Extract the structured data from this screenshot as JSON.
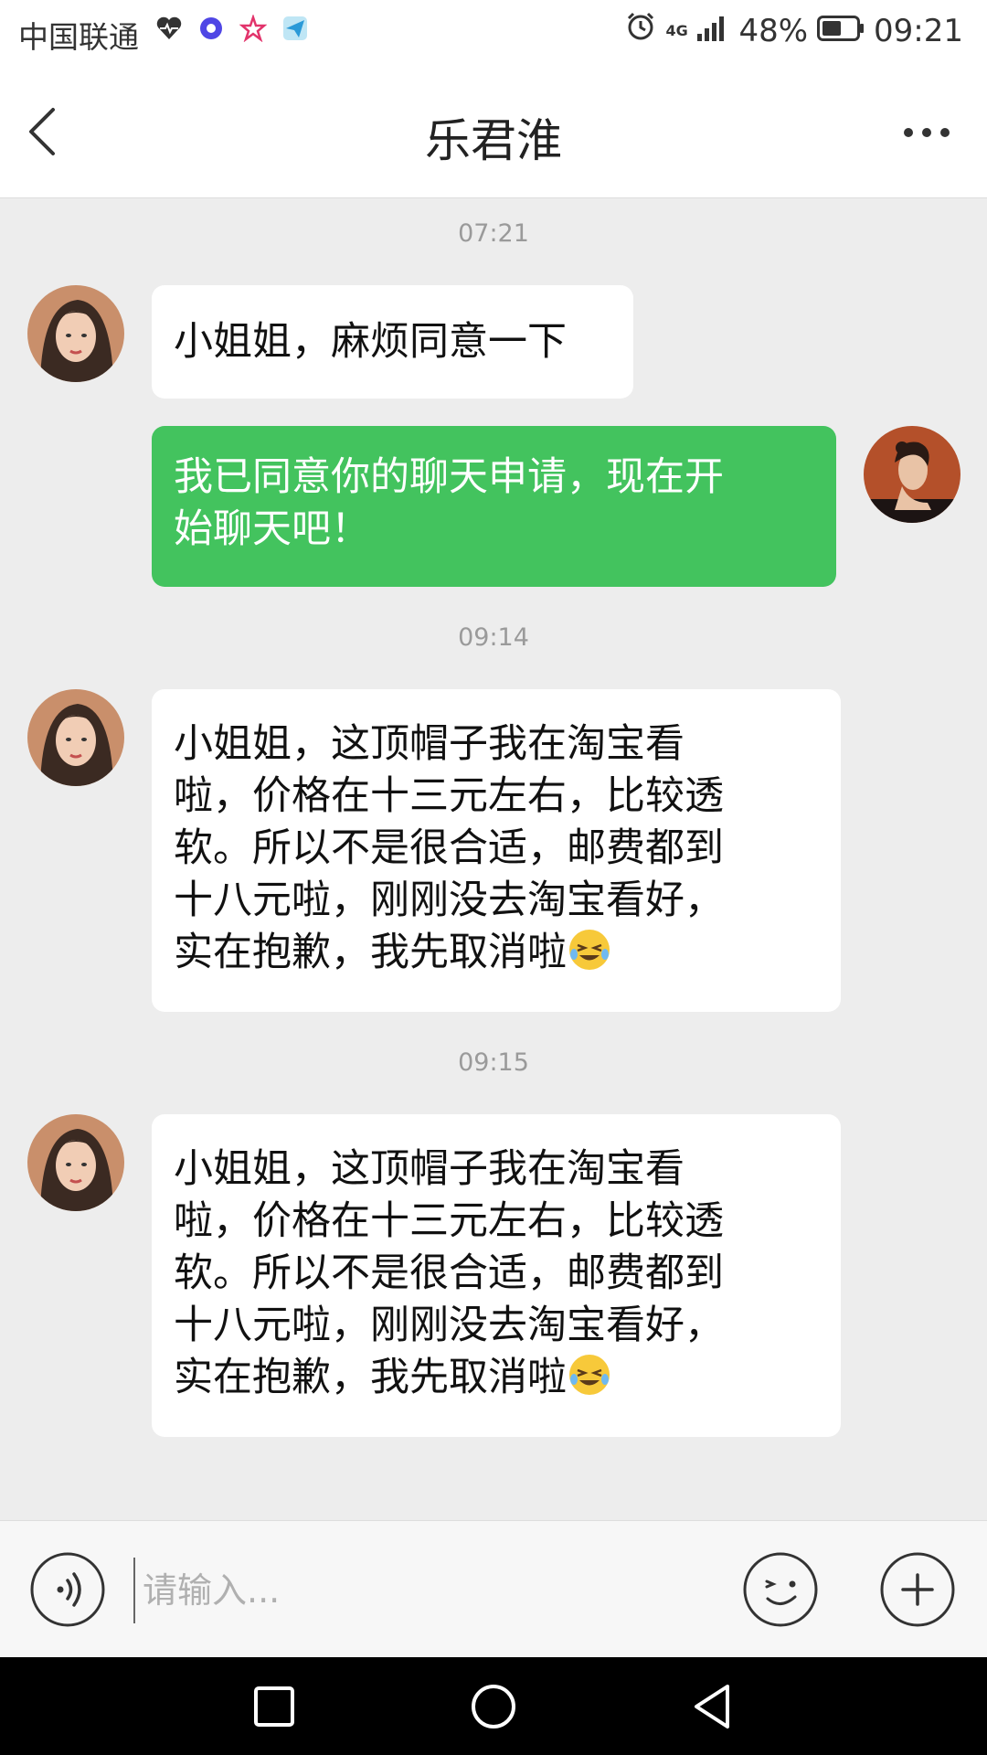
{
  "status_bar": {
    "carrier": "中国联通",
    "network": "4G",
    "battery": "48%",
    "time": "09:21",
    "icons": [
      "heart-rate-icon",
      "browser-icon",
      "star-app-icon",
      "send-app-icon",
      "alarm-icon",
      "signal-icon",
      "battery-icon"
    ]
  },
  "header": {
    "title": "乐君淮",
    "icons": [
      "back-arrow-icon",
      "more-dots-icon"
    ]
  },
  "messages": [
    {
      "time": "07:21"
    },
    {
      "side": "left",
      "text": "小姐姐，麻烦同意一下"
    },
    {
      "side": "right",
      "lines": [
        "我已同意你的聊天申请，现在开",
        "始聊天吧！"
      ]
    },
    {
      "time": "09:14"
    },
    {
      "side": "left",
      "lines": [
        "小姐姐，这顶帽子我在淘宝看",
        "啦，价格在十三元左右，比较透",
        "软。所以不是很合适，邮费都到",
        "十八元啦，刚刚没去淘宝看好，",
        "实在抱歉，我先取消啦"
      ],
      "emoji": "laugh-cry-emoji"
    },
    {
      "time": "09:15"
    },
    {
      "side": "left",
      "lines": [
        "小姐姐，这顶帽子我在淘宝看",
        "啦，价格在十三元左右，比较透",
        "软。所以不是很合适，邮费都到",
        "十八元啦，刚刚没去淘宝看好，",
        "实在抱歉，我先取消啦"
      ],
      "emoji": "laugh-cry-emoji"
    }
  ],
  "input_bar": {
    "placeholder": "请输入...",
    "value": "",
    "icons": [
      "voice-icon",
      "emoji-icon",
      "plus-icon"
    ]
  },
  "nav_bar": {
    "icons": [
      "recent-apps-icon",
      "home-icon",
      "back-icon"
    ]
  },
  "colors": {
    "sent_bubble": "#43c35e",
    "received_bubble": "#ffffff",
    "chat_background": "#ededed"
  }
}
